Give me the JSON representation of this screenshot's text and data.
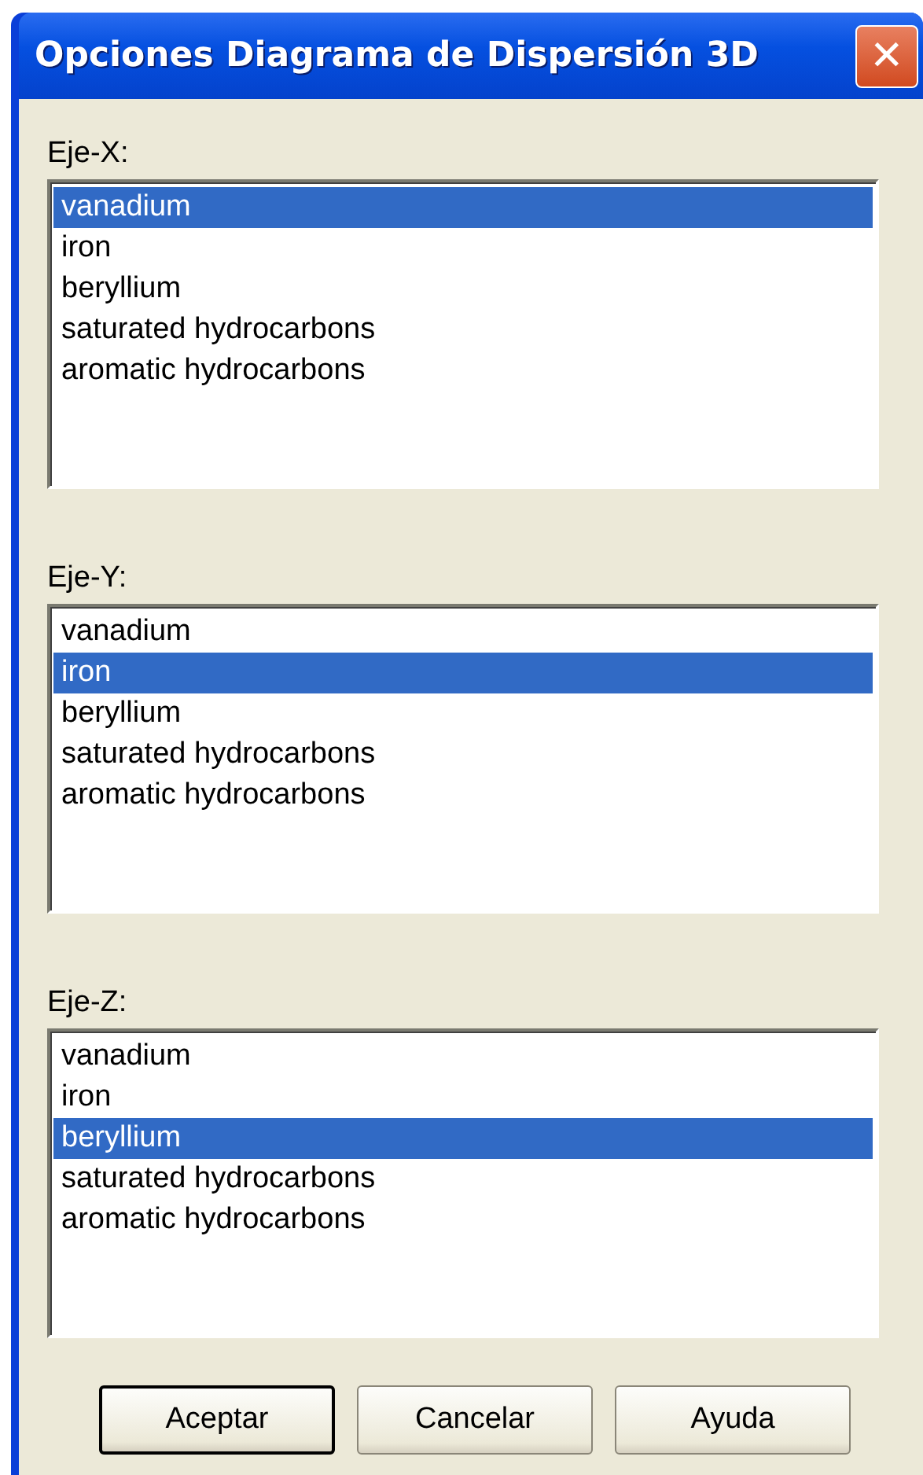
{
  "window": {
    "title": "Opciones Diagrama de Dispersión 3D",
    "close": "✕"
  },
  "lists": [
    {
      "label": "Eje-X:",
      "items": [
        {
          "text": "vanadium",
          "selected": true
        },
        {
          "text": "iron",
          "selected": false
        },
        {
          "text": "beryllium",
          "selected": false
        },
        {
          "text": "saturated hydrocarbons",
          "selected": false
        },
        {
          "text": "aromatic hydrocarbons",
          "selected": false
        }
      ]
    },
    {
      "label": "Eje-Y:",
      "items": [
        {
          "text": "vanadium",
          "selected": false
        },
        {
          "text": "iron",
          "selected": true
        },
        {
          "text": "beryllium",
          "selected": false
        },
        {
          "text": "saturated hydrocarbons",
          "selected": false
        },
        {
          "text": "aromatic hydrocarbons",
          "selected": false
        }
      ]
    },
    {
      "label": "Eje-Z:",
      "items": [
        {
          "text": "vanadium",
          "selected": false
        },
        {
          "text": "iron",
          "selected": false
        },
        {
          "text": "beryllium",
          "selected": true
        },
        {
          "text": "saturated hydrocarbons",
          "selected": false
        },
        {
          "text": "aromatic hydrocarbons",
          "selected": false
        }
      ]
    }
  ],
  "buttons": [
    {
      "label": "Aceptar",
      "default": true
    },
    {
      "label": "Cancelar",
      "default": false
    },
    {
      "label": "Ayuda",
      "default": false
    }
  ]
}
